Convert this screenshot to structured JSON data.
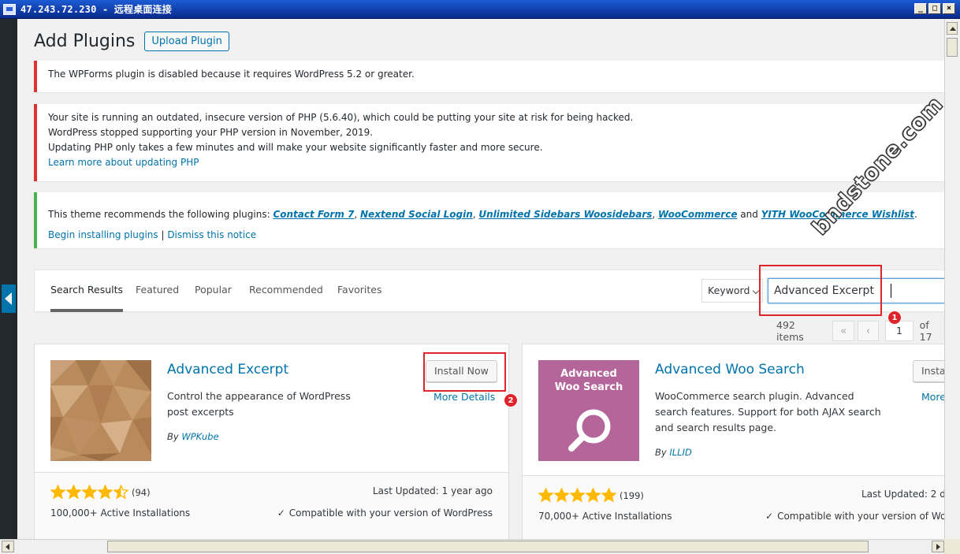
{
  "window": {
    "title": "47.243.72.230 - 远程桌面连接",
    "minimize": "_",
    "maximize": "□",
    "close": "×"
  },
  "page": {
    "title": "Add Plugins",
    "upload_label": "Upload Plugin"
  },
  "notices": {
    "wpforms": "The WPForms plugin is disabled because it requires WordPress 5.2 or greater.",
    "php_line1": "Your site is running an outdated, insecure version of PHP (5.6.40), which could be putting your site at risk for being hacked.",
    "php_line2": "WordPress stopped supporting your PHP version in November, 2019.",
    "php_line3": "Updating PHP only takes a few minutes and will make your website significantly faster and more secure.",
    "php_link": "Learn more about updating PHP",
    "theme_prefix": "This theme recommends the following plugins: ",
    "theme_plugins": [
      "Contact Form 7",
      "Nextend Social Login",
      "Unlimited Sidebars Woosidebars",
      "WooCommerce",
      "YITH WooCommerce Wishlist"
    ],
    "sep_comma": ", ",
    "sep_and": " and ",
    "period": ".",
    "begin_link": "Begin installing plugins",
    "pipe": " | ",
    "dismiss_link": "Dismiss this notice"
  },
  "filter": {
    "tabs": [
      "Search Results",
      "Featured",
      "Popular",
      "Recommended",
      "Favorites"
    ],
    "search_type": "Keyword",
    "search_value": "Advanced Excerpt"
  },
  "pagination": {
    "count": "492 items",
    "first": "«",
    "prev": "‹",
    "current": "1",
    "of_total": "of 17"
  },
  "cards": [
    {
      "name": "Advanced Excerpt",
      "description": "Control the appearance of WordPress post excerpts",
      "by": "By ",
      "author": "WPKube",
      "install_label": "Install Now",
      "more_label": "More Details",
      "rating_count": "(94)",
      "installs": "100,000+ Active Installations",
      "last_updated": "Last Updated: 1 year ago",
      "compat": "Compatible with your version of WordPress",
      "rating": 4.5
    },
    {
      "name": "Advanced Woo Search",
      "icon_text_1": "Advanced",
      "icon_text_2": "Woo Search",
      "description": "WooCommerce search plugin. Advanced search features. Support for both AJAX search and search results page.",
      "by": "By ",
      "author": "ILLID",
      "install_label": "Instal",
      "more_label": "More",
      "rating_count": "(199)",
      "installs": "70,000+ Active Installations",
      "last_updated": "Last Updated: 2 d",
      "compat": "Compatible with your version of Wo",
      "rating": 5
    }
  ],
  "annotations": {
    "badge1": "1",
    "badge2": "2",
    "watermark": "bndstone.com"
  },
  "colors": {
    "wp_link": "#0073aa",
    "notice_error": "#dc3232",
    "notice_success": "#46b450",
    "star": "#ffb900",
    "annotation_red": "#e0242b"
  }
}
